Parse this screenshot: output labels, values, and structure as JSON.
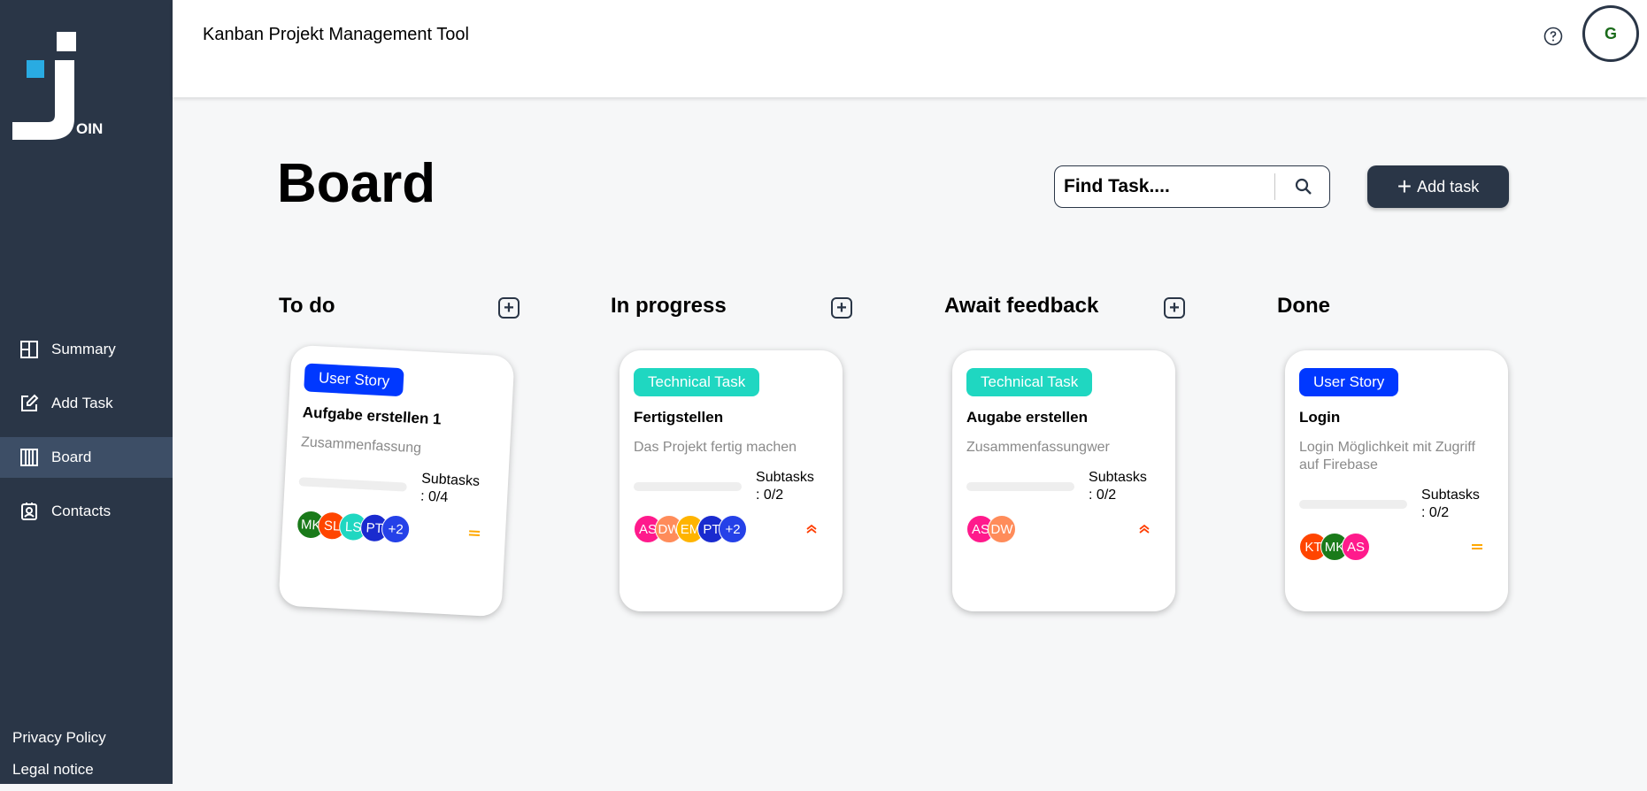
{
  "app": {
    "header_title": "Kanban Projekt Management Tool",
    "user_initial": "G",
    "logo_letters": "OIN"
  },
  "sidebar": {
    "items": [
      {
        "label": "Summary",
        "icon": "summary-icon"
      },
      {
        "label": "Add Task",
        "icon": "edit-icon"
      },
      {
        "label": "Board",
        "icon": "board-icon",
        "active": true
      },
      {
        "label": "Contacts",
        "icon": "contacts-icon"
      }
    ],
    "footer": {
      "privacy": "Privacy Policy",
      "legal": "Legal notice"
    }
  },
  "board": {
    "title": "Board",
    "search_placeholder": "Find Task....",
    "add_task_label": "Add task"
  },
  "columns": [
    {
      "title": "To do",
      "has_add": true
    },
    {
      "title": "In progress",
      "has_add": true
    },
    {
      "title": "Await feedback",
      "has_add": true
    },
    {
      "title": "Done",
      "has_add": false
    }
  ],
  "cards": [
    {
      "column": "To do",
      "label": "User Story",
      "title": "Aufgabe erstellen 1",
      "description": "Zusammenfassung",
      "subtasks_line1": "Subtasks",
      "subtasks_line2": ": 0/4",
      "subtasks_done": 0,
      "subtasks_total": 4,
      "avatars": [
        "MK",
        "SL",
        "LS",
        "PT",
        "+2"
      ],
      "priority": "medium"
    },
    {
      "column": "In progress",
      "label": "Technical Task",
      "title": "Fertigstellen",
      "description": "Das Projekt fertig machen",
      "subtasks_line1": "Subtasks",
      "subtasks_line2": ": 0/2",
      "subtasks_done": 0,
      "subtasks_total": 2,
      "avatars": [
        "AS",
        "DW",
        "EM",
        "PT",
        "+2"
      ],
      "priority": "urgent"
    },
    {
      "column": "Await feedback",
      "label": "Technical Task",
      "title": "Augabe erstellen",
      "description": "Zusammenfassungwer",
      "subtasks_line1": "Subtasks",
      "subtasks_line2": ": 0/2",
      "subtasks_done": 0,
      "subtasks_total": 2,
      "avatars": [
        "AS",
        "DW"
      ],
      "priority": "urgent"
    },
    {
      "column": "Done",
      "label": "User Story",
      "title": "Login",
      "description": "Login Möglichkeit mit Zugriff auf Firebase",
      "subtasks_line1": "Subtasks",
      "subtasks_line2": ": 0/2",
      "subtasks_done": 0,
      "subtasks_total": 2,
      "avatars": [
        "KT",
        "MK",
        "AS"
      ],
      "priority": "medium"
    }
  ],
  "colors": {
    "sidebar": "#2a3647",
    "user_story": "#0038ff",
    "technical_task": "#1fd7c1",
    "urgent": "#ff3d00",
    "medium": "#ffa800",
    "avatar_colors": {
      "MK": "#1a7a1a",
      "SL": "#ff4500",
      "LS": "#1fd7c1",
      "PT": "#1a2bcf",
      "+2": "#2541e8",
      "AS": "#ff1a8c",
      "DW": "#ff8c5a",
      "EM": "#ffb400",
      "KT": "#ff4500"
    }
  }
}
